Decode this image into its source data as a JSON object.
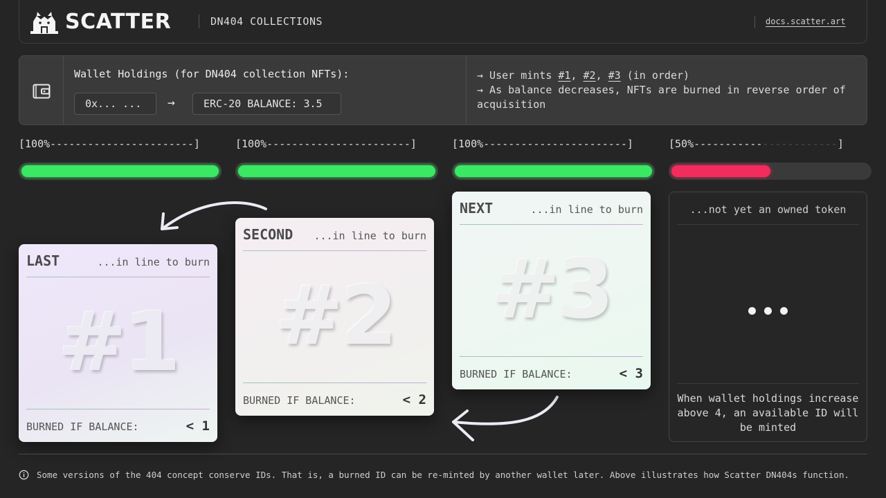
{
  "header": {
    "brand": "SCATTER",
    "subtitle": "DN404 COLLECTIONS",
    "docs_link": "docs.scatter.art"
  },
  "holdings": {
    "label": "Wallet Holdings (for DN404 collection NFTs):",
    "address": "0x... ...",
    "arrow": "→",
    "balance": "ERC-20 BALANCE: 3.5",
    "note_1_prefix": "→ User mints ",
    "note_1_id1": "#1",
    "note_1_sep1": ", ",
    "note_1_id2": "#2",
    "note_1_sep2": ", ",
    "note_1_id3": "#3",
    "note_1_suffix": " (in order)",
    "note_2": "→ As balance decreases, NFTs are burned in reverse order of acquisition"
  },
  "progress": [
    {
      "label_bright": "[100%-----------------------]",
      "label_dim": "",
      "label_end": "",
      "fill": 1.0,
      "color": "#3be864"
    },
    {
      "label_bright": "[100%-----------------------]",
      "label_dim": "",
      "label_end": "",
      "fill": 1.0,
      "color": "#3be864"
    },
    {
      "label_bright": "[100%-----------------------]",
      "label_dim": "",
      "label_end": "",
      "fill": 1.0,
      "color": "#3be864"
    },
    {
      "label_bright": "[50%-----------",
      "label_dim": "------------",
      "label_end": "]",
      "fill": 0.5,
      "color": "#f22c5c"
    }
  ],
  "cards": [
    {
      "position": "LAST",
      "note": "...in line to burn",
      "id": "#1",
      "burn_label": "BURNED IF BALANCE:",
      "burn_value": "< 1"
    },
    {
      "position": "SECOND",
      "note": "...in line to burn",
      "id": "#2",
      "burn_label": "BURNED IF BALANCE:",
      "burn_value": "< 2"
    },
    {
      "position": "NEXT",
      "note": "...in line to burn",
      "id": "#3",
      "burn_label": "BURNED IF BALANCE:",
      "burn_value": "< 3"
    }
  ],
  "future_card": {
    "note": "...not yet an owned token",
    "text": "When wallet holdings increase above 4, an available ID will be minted"
  },
  "footnote": "Some versions of the 404 concept conserve IDs. That is, a burned ID can be re-minted by another wallet later. Above illustrates how Scatter DN404s function.",
  "icons": [
    "scatter-cat-logo-icon",
    "wallet-icon",
    "info-icon",
    "curved-arrow-icon"
  ],
  "colors": {
    "background": "#252525",
    "green": "#3be864",
    "red": "#f22c5c"
  }
}
